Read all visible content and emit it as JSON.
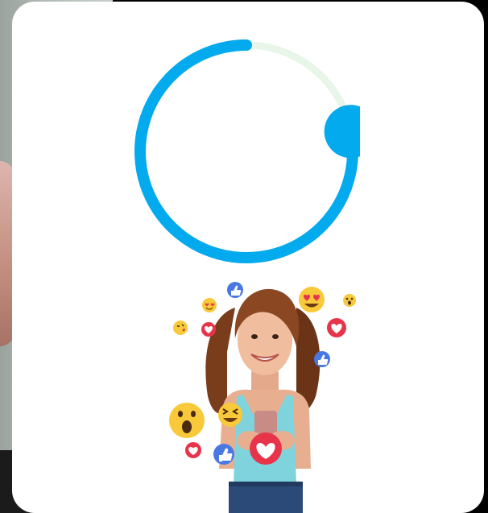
{
  "loader": {
    "progress": 0.78,
    "track_color": "#e8f5e9",
    "arc_color": "#03aaee",
    "knob_color": "#03aaee"
  },
  "illustration": {
    "subject": "woman-with-phone",
    "reactions": [
      "thumbs-up-icon",
      "heart-eyes-icon",
      "surprised-icon",
      "kiss-icon",
      "heart-icon",
      "laugh-icon"
    ]
  },
  "colors": {
    "card_bg": "#ffffff",
    "page_bg": "#000000",
    "like_blue": "#4a78e2",
    "heart_red": "#e8344b",
    "emoji_yellow": "#f8c93a"
  }
}
